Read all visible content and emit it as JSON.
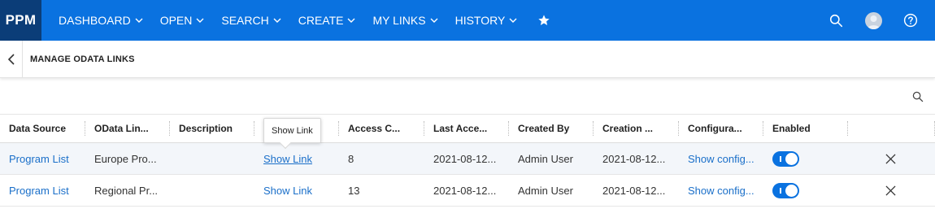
{
  "app": {
    "logo": "PPM",
    "brand_color": "#0a72e0",
    "logo_bg": "#0b3d78"
  },
  "nav": {
    "items": [
      {
        "label": "DASHBOARD"
      },
      {
        "label": "OPEN"
      },
      {
        "label": "SEARCH"
      },
      {
        "label": "CREATE"
      },
      {
        "label": "MY LINKS"
      },
      {
        "label": "HISTORY"
      }
    ],
    "icons": [
      "star-icon",
      "search-icon",
      "avatar",
      "help-icon"
    ]
  },
  "page": {
    "title": "MANAGE ODATA LINKS"
  },
  "table": {
    "columns": [
      "Data Source",
      "OData Lin...",
      "Description",
      "",
      "Access C...",
      "Last Acce...",
      "Created By",
      "Creation ...",
      "Configura...",
      "Enabled",
      ""
    ],
    "rows": [
      {
        "data_source": "Program List",
        "odata_link": "Europe Pro...",
        "description": "",
        "link": "Show Link",
        "access_count": "8",
        "last_access": "2021-08-12...",
        "created_by": "Admin User",
        "creation": "2021-08-12...",
        "configuration": "Show config...",
        "enabled": true
      },
      {
        "data_source": "Program List",
        "odata_link": "Regional Pr...",
        "description": "",
        "link": "Show Link",
        "access_count": "13",
        "last_access": "2021-08-12...",
        "created_by": "Admin User",
        "creation": "2021-08-12...",
        "configuration": "Show config...",
        "enabled": true
      }
    ]
  },
  "tooltip": {
    "text": "Show Link"
  }
}
